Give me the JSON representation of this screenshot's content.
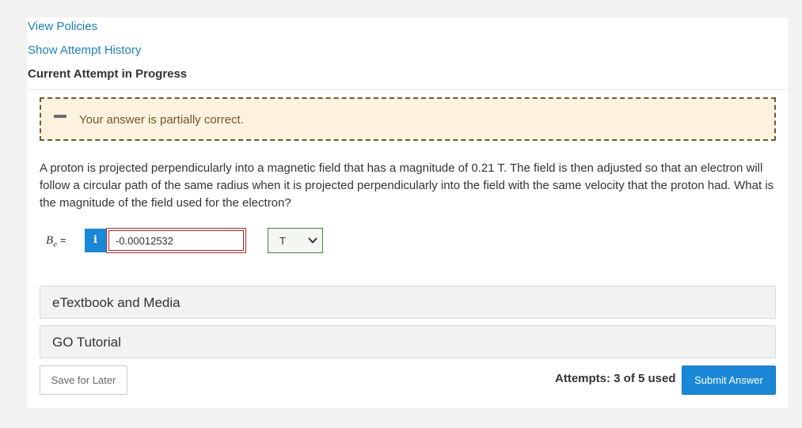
{
  "nav": {
    "view_policies": "View Policies",
    "show_attempt_history": "Show Attempt History"
  },
  "status": {
    "current_attempt": "Current Attempt in Progress"
  },
  "feedback": {
    "message": "Your answer is partially correct.",
    "icon": "minus-icon"
  },
  "question": {
    "text": "A proton is projected perpendicularly into a magnetic field that has a magnitude of 0.21 T. The field is then adjusted so that an electron will follow a circular path of the same radius when it is projected perpendicularly into the field with the same velocity that the proton had. What is the magnitude of the field used for the electron?"
  },
  "answer": {
    "var_symbol": "B",
    "var_subscript": "e",
    "equals": "=",
    "info_label": "i",
    "value": "-0.00012532",
    "unit": "T"
  },
  "resources": {
    "etextbook": "eTextbook and Media",
    "go_tutorial": "GO Tutorial"
  },
  "footer": {
    "save_label": "Save for Later",
    "attempts": "Attempts: 3 of 5 used",
    "submit_label": "Submit Answer"
  },
  "colors": {
    "link": "#1f7fb8",
    "primary_button": "#1a88d6",
    "alert_background": "#fcf2dd",
    "input_error_border": "#aa2b2b",
    "unit_border": "#4e7a47"
  }
}
